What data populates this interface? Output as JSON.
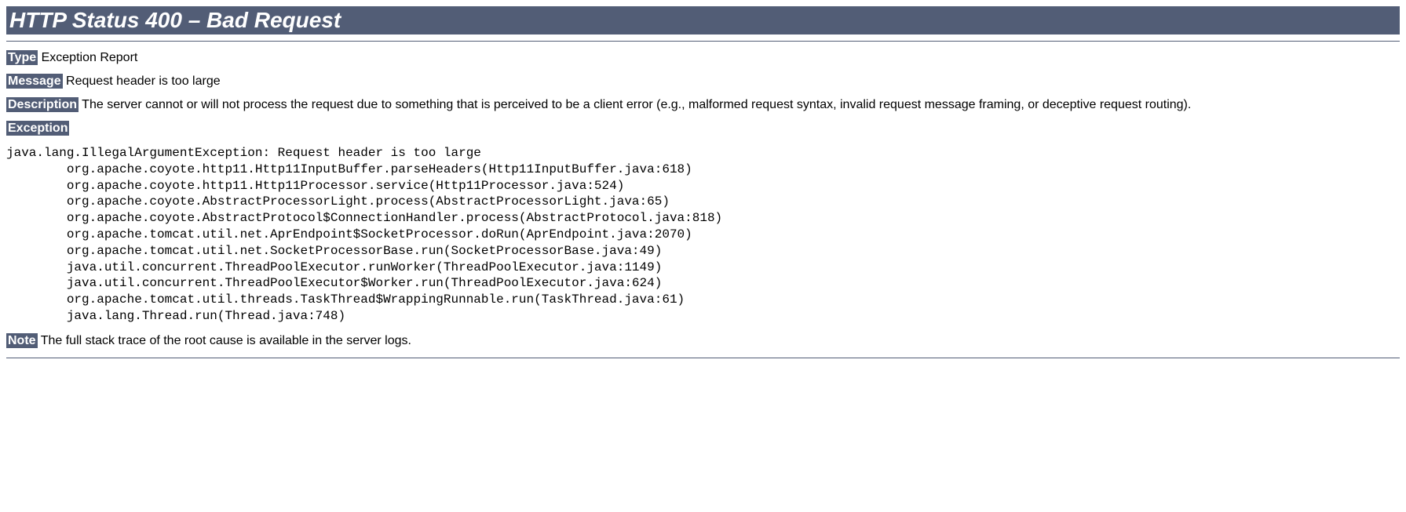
{
  "title": "HTTP Status 400 – Bad Request",
  "type_label": "Type",
  "type_value": " Exception Report",
  "message_label": "Message",
  "message_value": " Request header is too large",
  "description_label": "Description",
  "description_value": " The server cannot or will not process the request due to something that is perceived to be a client error (e.g., malformed request syntax, invalid request message framing, or deceptive request routing).",
  "exception_label": "Exception",
  "stacktrace": "java.lang.IllegalArgumentException: Request header is too large\n\torg.apache.coyote.http11.Http11InputBuffer.parseHeaders(Http11InputBuffer.java:618)\n\torg.apache.coyote.http11.Http11Processor.service(Http11Processor.java:524)\n\torg.apache.coyote.AbstractProcessorLight.process(AbstractProcessorLight.java:65)\n\torg.apache.coyote.AbstractProtocol$ConnectionHandler.process(AbstractProtocol.java:818)\n\torg.apache.tomcat.util.net.AprEndpoint$SocketProcessor.doRun(AprEndpoint.java:2070)\n\torg.apache.tomcat.util.net.SocketProcessorBase.run(SocketProcessorBase.java:49)\n\tjava.util.concurrent.ThreadPoolExecutor.runWorker(ThreadPoolExecutor.java:1149)\n\tjava.util.concurrent.ThreadPoolExecutor$Worker.run(ThreadPoolExecutor.java:624)\n\torg.apache.tomcat.util.threads.TaskThread$WrappingRunnable.run(TaskThread.java:61)\n\tjava.lang.Thread.run(Thread.java:748)",
  "note_label": "Note",
  "note_value": " The full stack trace of the root cause is available in the server logs."
}
